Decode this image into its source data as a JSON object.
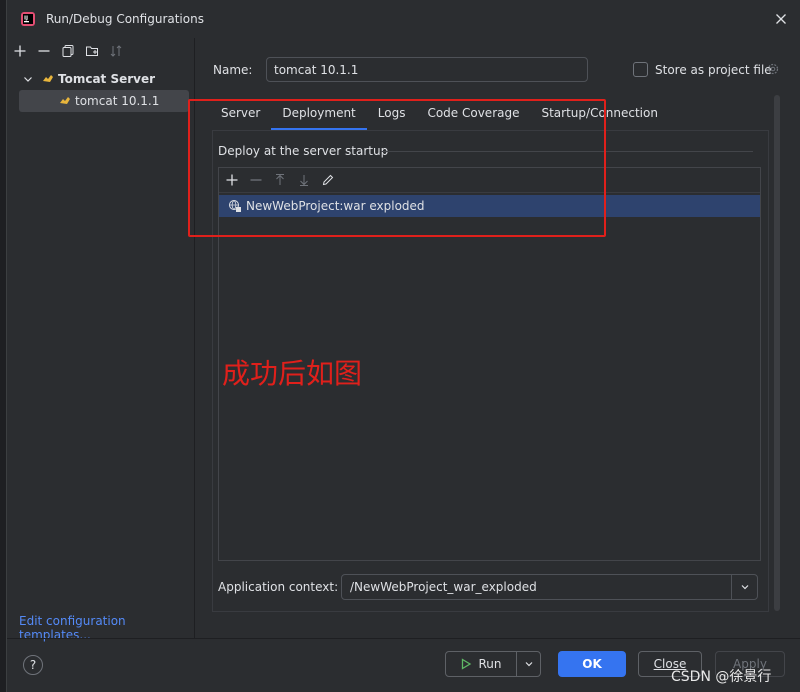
{
  "window": {
    "title": "Run/Debug Configurations"
  },
  "left_panel": {
    "group_label": "Tomcat Server",
    "child_label": "tomcat 10.1.1",
    "edit_templates": "Edit configuration templates..."
  },
  "form": {
    "name_label": "Name:",
    "name_value": "tomcat 10.1.1",
    "store_label": "Store as project file",
    "store_checked": false
  },
  "tabs": [
    {
      "label": "Server",
      "active": false
    },
    {
      "label": "Deployment",
      "active": true
    },
    {
      "label": "Logs",
      "active": false
    },
    {
      "label": "Code Coverage",
      "active": false
    },
    {
      "label": "Startup/Connection",
      "active": false
    }
  ],
  "deployment": {
    "section_title": "Deploy at the server startup",
    "artifacts": [
      "NewWebProject:war exploded"
    ],
    "context_label": "Application context:",
    "context_value": "/NewWebProject_war_exploded"
  },
  "annotation": {
    "text": "成功后如图",
    "color": "#e0201b"
  },
  "buttons": {
    "run": "Run",
    "ok": "OK",
    "close": "Close",
    "apply": "Apply",
    "help": "?"
  },
  "watermark": "CSDN @徐景行",
  "colors": {
    "accent": "#3574f0",
    "selection": "#2e436e",
    "link": "#548af7"
  }
}
